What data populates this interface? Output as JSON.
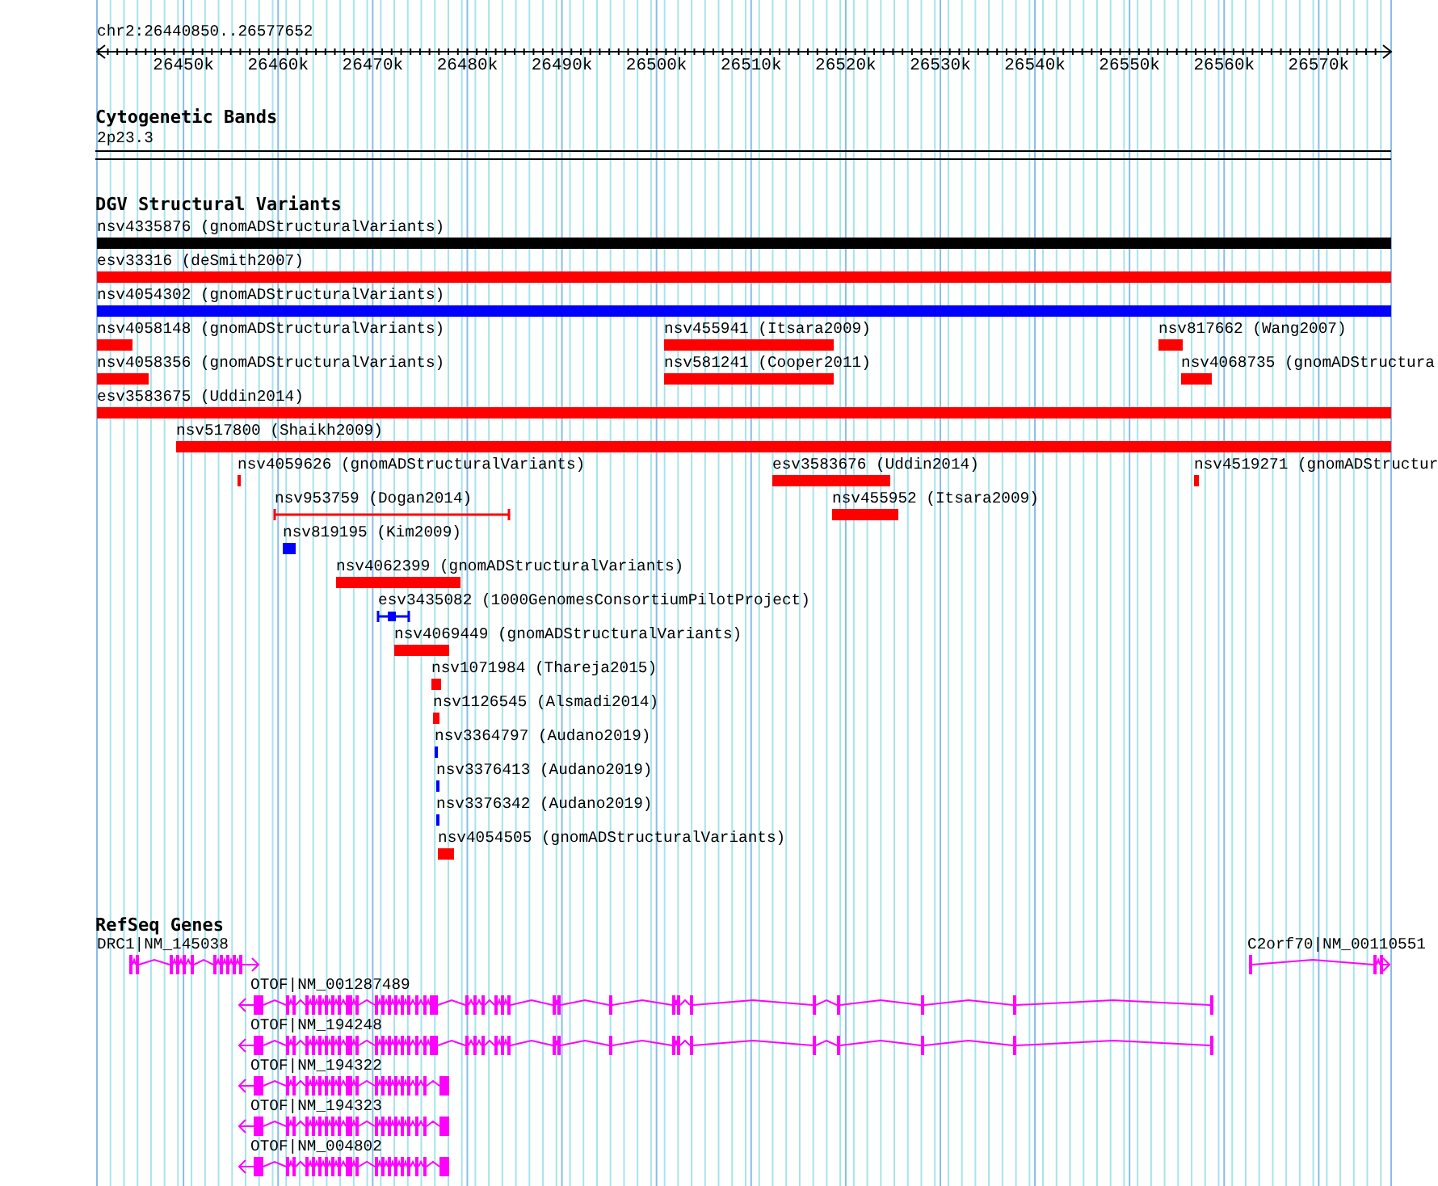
{
  "ruler": {
    "location": "chr2:26440850..26577652",
    "tick_labels": [
      "26450k",
      "26460k",
      "26470k",
      "26480k",
      "26490k",
      "26500k",
      "26510k",
      "26520k",
      "26530k",
      "26540k",
      "26550k",
      "26560k",
      "26570k"
    ]
  },
  "tracks": [
    {
      "kind": "cytoband",
      "title": "Cytogenetic Bands",
      "band": "2p23.3"
    },
    {
      "kind": "variants",
      "title": "DGV Structural Variants",
      "features": [
        {
          "label": "nsv4335876 (gnomADStructuralVariants)",
          "kind": "bar",
          "color": "#000000"
        },
        {
          "label": "esv33316 (deSmith2007)",
          "kind": "bar",
          "color": "#ff0000"
        },
        {
          "label": "nsv4054302 (gnomADStructuralVariants)",
          "kind": "bar",
          "color": "#0000ff"
        },
        {
          "label": "nsv4058148 (gnomADStructuralVariants)",
          "kind": "bar",
          "color": "#ff0000"
        },
        {
          "label": "nsv455941 (Itsara2009)",
          "kind": "bar",
          "color": "#ff0000"
        },
        {
          "label": "nsv817662 (Wang2007)",
          "kind": "bar",
          "color": "#ff0000"
        },
        {
          "label": "nsv4058356 (gnomADStructuralVariants)",
          "kind": "bar",
          "color": "#ff0000"
        },
        {
          "label": "nsv581241 (Cooper2011)",
          "kind": "bar",
          "color": "#ff0000"
        },
        {
          "label": "nsv4068735 (gnomADStructura",
          "kind": "bar",
          "color": "#ff0000"
        },
        {
          "label": "esv3583675 (Uddin2014)",
          "kind": "bar",
          "color": "#ff0000"
        },
        {
          "label": "nsv517800 (Shaikh2009)",
          "kind": "bar",
          "color": "#ff0000"
        },
        {
          "label": "nsv4059626 (gnomADStructuralVariants)",
          "kind": "bar",
          "color": "#ff0000"
        },
        {
          "label": "esv3583676 (Uddin2014)",
          "kind": "bar",
          "color": "#ff0000"
        },
        {
          "label": "nsv4519271 (gnomADStructur",
          "kind": "bar",
          "color": "#ff0000"
        },
        {
          "label": "nsv953759 (Dogan2014)",
          "kind": "interval",
          "color": "#ff0000"
        },
        {
          "label": "nsv455952 (Itsara2009)",
          "kind": "bar",
          "color": "#ff0000"
        },
        {
          "label": "nsv819195 (Kim2009)",
          "kind": "bar",
          "color": "#0000ff"
        },
        {
          "label": "nsv4062399 (gnomADStructuralVariants)",
          "kind": "bar",
          "color": "#ff0000"
        },
        {
          "label": "esv3435082 (1000GenomesConsortiumPilotProject)",
          "kind": "dumbbell",
          "color": "#0000ff"
        },
        {
          "label": "nsv4069449 (gnomADStructuralVariants)",
          "kind": "bar",
          "color": "#ff0000"
        },
        {
          "label": "nsv1071984 (Thareja2015)",
          "kind": "bar",
          "color": "#ff0000"
        },
        {
          "label": "nsv1126545 (Alsmadi2014)",
          "kind": "bar",
          "color": "#ff0000"
        },
        {
          "label": "nsv3364797 (Audano2019)",
          "kind": "bar",
          "color": "#0000ff"
        },
        {
          "label": "nsv3376413 (Audano2019)",
          "kind": "bar",
          "color": "#0000ff"
        },
        {
          "label": "nsv3376342 (Audano2019)",
          "kind": "bar",
          "color": "#0000ff"
        },
        {
          "label": "nsv4054505 (gnomADStructuralVariants)",
          "kind": "bar",
          "color": "#ff0000"
        }
      ]
    },
    {
      "kind": "genes",
      "title": "RefSeq Genes",
      "genes": [
        {
          "label": "DRC1|NM_145038",
          "reverse_strand": false
        },
        {
          "label": "C2orf70|NM_00110551",
          "reverse_strand": false
        },
        {
          "label": "OTOF|NM_001287489",
          "reverse_strand": true
        },
        {
          "label": "OTOF|NM_194248",
          "reverse_strand": true
        },
        {
          "label": "OTOF|NM_194322",
          "reverse_strand": true
        },
        {
          "label": "OTOF|NM_194323",
          "reverse_strand": true
        },
        {
          "label": "OTOF|NM_004802",
          "reverse_strand": true
        }
      ]
    }
  ]
}
